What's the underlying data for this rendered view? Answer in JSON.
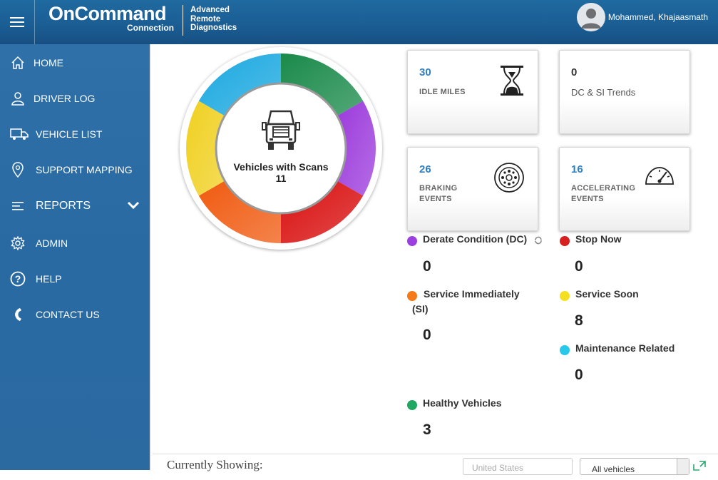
{
  "header": {
    "logo_main": "OnCommand",
    "logo_sub": "Connection",
    "logo_ard_1": "Advanced",
    "logo_ard_2": "Remote",
    "logo_ard_3": "Diagnostics",
    "user_name": "Mohammed, Khajaasmath"
  },
  "sidebar": {
    "items": [
      {
        "label": "HOME",
        "icon": "home-icon"
      },
      {
        "label": "DRIVER LOG",
        "icon": "person-icon"
      },
      {
        "label": "VEHICLE LIST",
        "icon": "truck-icon"
      },
      {
        "label": "SUPPORT MAPPING",
        "icon": "map-pin-icon"
      },
      {
        "label": "REPORTS",
        "icon": "list-icon"
      },
      {
        "label": "ADMIN",
        "icon": "gear-icon"
      },
      {
        "label": "HELP",
        "icon": "question-icon"
      },
      {
        "label": "CONTACT US",
        "icon": "phone-icon"
      }
    ]
  },
  "donut": {
    "label": "Vehicles with Scans",
    "count": "11",
    "colors": [
      "#1a8a4a",
      "#9c3bdc",
      "#d91010",
      "#f05a10",
      "#f0d020",
      "#1aa8e0"
    ]
  },
  "cards": {
    "idle": {
      "value": "30",
      "label": "IDLE MILES"
    },
    "dcsi": {
      "value": "0",
      "label": "DC & SI Trends"
    },
    "braking": {
      "value": "26",
      "label1": "BRAKING",
      "label2": "EVENTS"
    },
    "accel": {
      "value": "16",
      "label1": "ACCELERATING",
      "label2": "EVENTS"
    }
  },
  "legend": {
    "derate": {
      "label": "Derate Condition (DC)",
      "value": "0",
      "color": "#9b3fe0"
    },
    "stop": {
      "label": "Stop Now",
      "value": "0",
      "color": "#d81f1f"
    },
    "service_imm_1": "Service Immediately",
    "service_imm_2": "(SI)",
    "service_imm_value": "0",
    "service_imm_color": "#f47a1a",
    "service_soon": {
      "label": "Service Soon",
      "value": "8",
      "color": "#f4e020"
    },
    "maintenance": {
      "label": "Maintenance Related",
      "value": "0",
      "color": "#28c8ea"
    },
    "healthy": {
      "label": "Healthy Vehicles",
      "value": "3",
      "color": "#1fa763"
    }
  },
  "footer": {
    "currently_showing": "Currently Showing:",
    "country_placeholder": "United States",
    "vehicles_select": "All vehicles"
  }
}
